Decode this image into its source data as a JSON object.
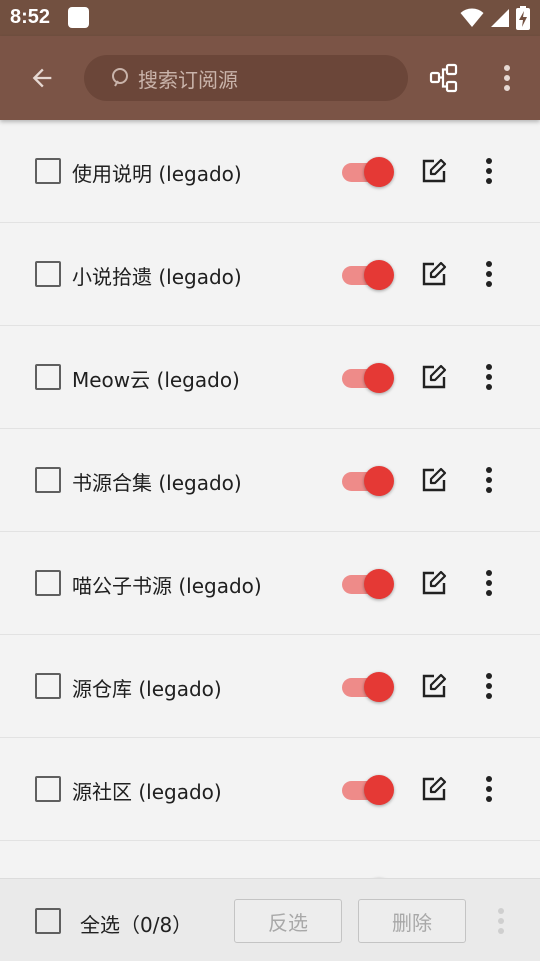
{
  "status_bar": {
    "time": "8:52",
    "icons": [
      "notification-square-icon",
      "wifi-icon",
      "signal-icon",
      "battery-charging-icon"
    ]
  },
  "toolbar": {
    "back_icon": "arrow-back-icon",
    "search_placeholder": "搜索订阅源",
    "group_icon": "group-tree-icon",
    "more_icon": "more-vert-icon",
    "colors": {
      "toolbar_bg": "#7b5446",
      "search_bg": "#6b4639"
    }
  },
  "sources": [
    {
      "name": "使用说明 (legado)",
      "checked": false,
      "enabled": true
    },
    {
      "name": "小说拾遗 (legado)",
      "checked": false,
      "enabled": true
    },
    {
      "name": "Meow云 (legado)",
      "checked": false,
      "enabled": true
    },
    {
      "name": "书源合集 (legado)",
      "checked": false,
      "enabled": true
    },
    {
      "name": "喵公子书源 (legado)",
      "checked": false,
      "enabled": true
    },
    {
      "name": "源仓库 (legado)",
      "checked": false,
      "enabled": true
    },
    {
      "name": "源社区 (legado)",
      "checked": false,
      "enabled": true
    },
    {
      "name": "",
      "checked": false,
      "enabled": true
    }
  ],
  "row_icons": {
    "edit": "edit-icon",
    "more": "more-vert-icon"
  },
  "accent_color": "#e53935",
  "bottom_bar": {
    "select_all_label": "全选（0/8）",
    "invert_label": "反选",
    "delete_label": "删除",
    "more_icon": "more-vert-icon"
  }
}
